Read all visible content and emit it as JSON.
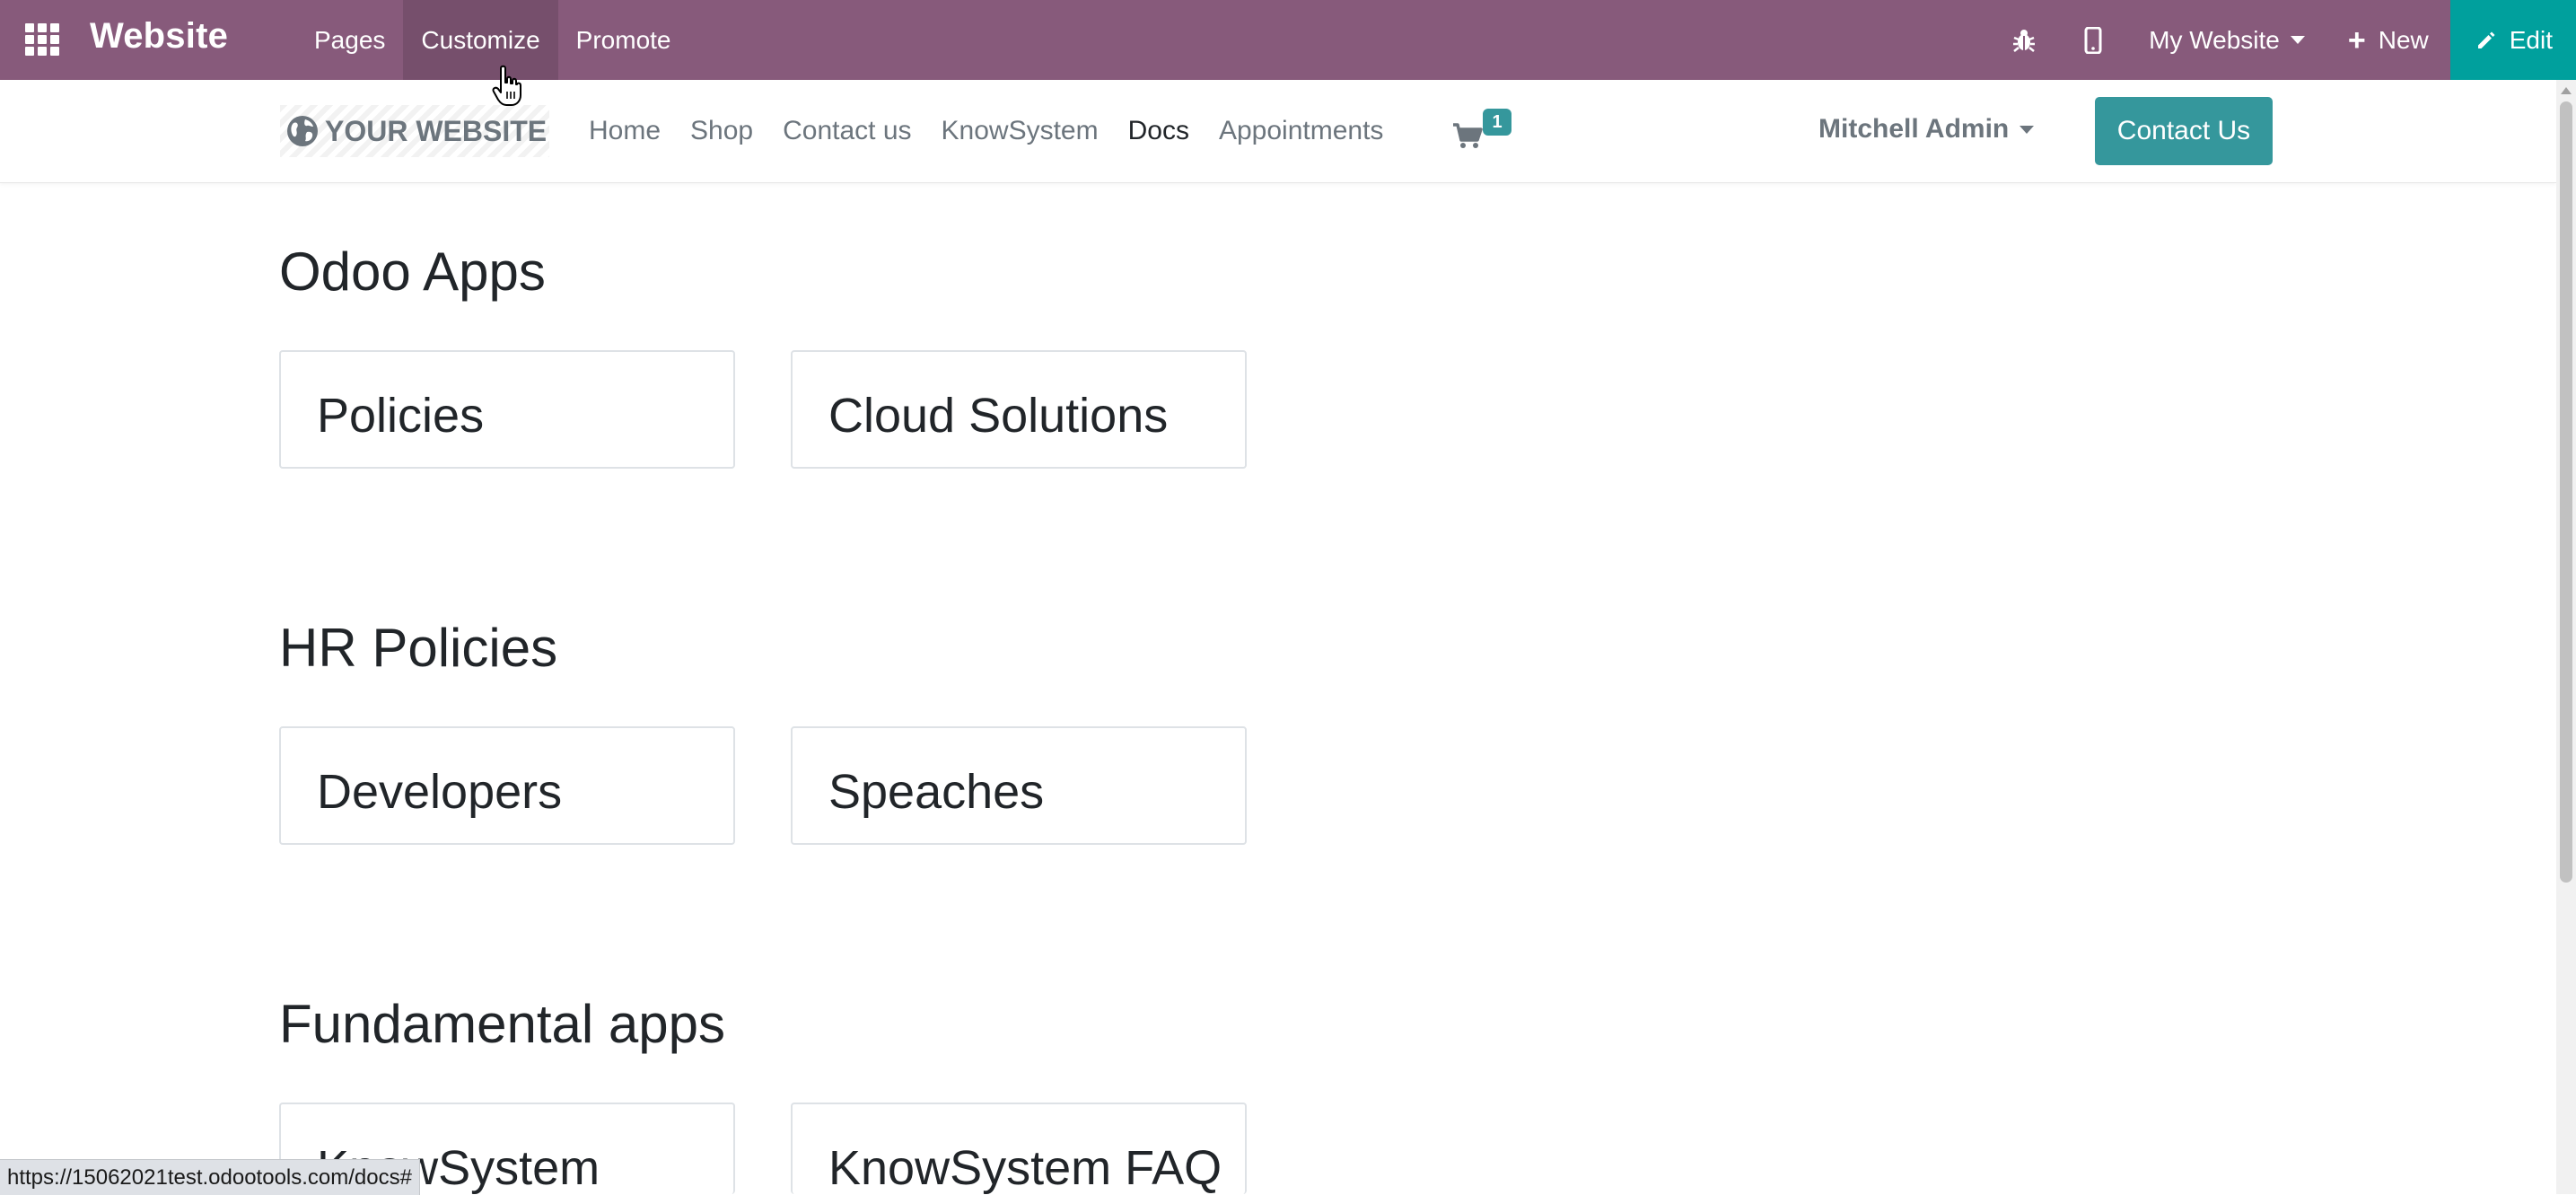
{
  "topbar": {
    "brand": "Website",
    "menu": [
      "Pages",
      "Customize",
      "Promote"
    ],
    "bug_icon": "bug-icon",
    "mobile_icon": "mobile-icon",
    "site_selector": "My Website",
    "new_label": "New",
    "edit_label": "Edit",
    "color": "#875a7b",
    "edit_color": "#00a09d"
  },
  "header": {
    "logo_text": "YOUR WEBSITE",
    "nav": [
      "Home",
      "Shop",
      "Contact us",
      "KnowSystem",
      "Docs",
      "Appointments"
    ],
    "active_nav": "Docs",
    "cart_count": "1",
    "user": "Mitchell Admin",
    "contact_button": "Contact Us",
    "accent_color": "#35979c"
  },
  "sections": [
    {
      "title": "Odoo Apps",
      "cards": [
        "Policies",
        "Cloud Solutions"
      ]
    },
    {
      "title": "HR Policies",
      "cards": [
        "Developers",
        "Speaches"
      ]
    },
    {
      "title": "Fundamental apps",
      "cards": [
        "KnowSystem",
        "KnowSystem FAQ"
      ]
    }
  ],
  "status_bar": {
    "url": "https://15062021test.odootools.com/docs#"
  }
}
